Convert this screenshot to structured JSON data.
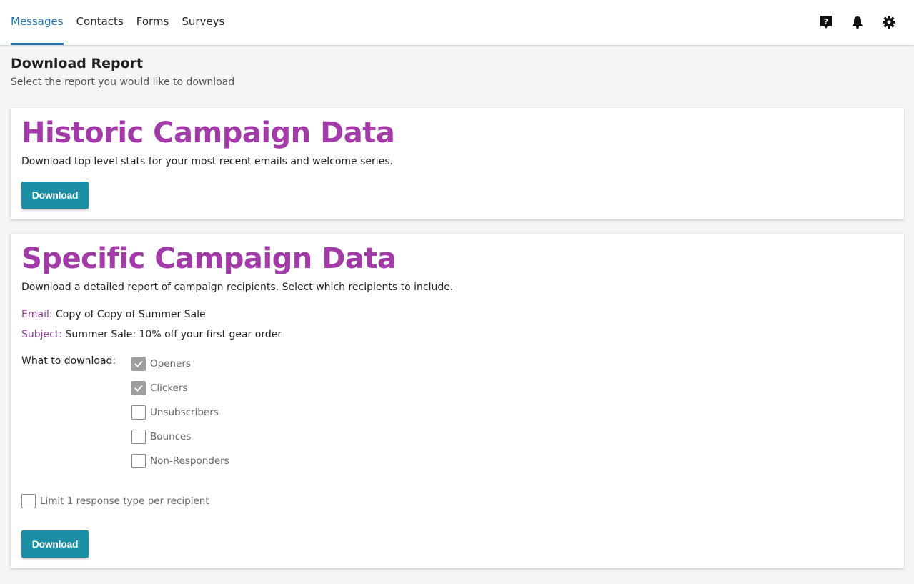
{
  "nav": {
    "items": [
      {
        "label": "Messages",
        "active": true
      },
      {
        "label": "Contacts",
        "active": false
      },
      {
        "label": "Forms",
        "active": false
      },
      {
        "label": "Surveys",
        "active": false
      }
    ],
    "icons": [
      "help-icon",
      "bell-icon",
      "gear-icon"
    ]
  },
  "page": {
    "title": "Download Report",
    "subtitle": "Select the report you would like to download"
  },
  "historic": {
    "heading": "Historic Campaign Data",
    "description": "Download top level stats for your most recent emails and welcome series.",
    "button_label": "Download"
  },
  "specific": {
    "heading": "Specific Campaign Data",
    "description": "Download a detailed report of campaign recipients. Select which recipients to include.",
    "email_label": "Email:",
    "email_value": "Copy of Copy of Summer Sale",
    "subject_label": "Subject:",
    "subject_value": "Summer Sale: 10% off your first gear order",
    "what_label": "What to download:",
    "options": [
      {
        "label": "Openers",
        "checked": true
      },
      {
        "label": "Clickers",
        "checked": true
      },
      {
        "label": "Unsubscribers",
        "checked": false
      },
      {
        "label": "Bounces",
        "checked": false
      },
      {
        "label": "Non-Responders",
        "checked": false
      }
    ],
    "limit_label": "Limit 1 response type per recipient",
    "limit_checked": false,
    "button_label": "Download"
  },
  "colors": {
    "accent_blue": "#1c74b8",
    "heading_purple": "#a23ba8",
    "button_teal": "#1a8fa6"
  }
}
